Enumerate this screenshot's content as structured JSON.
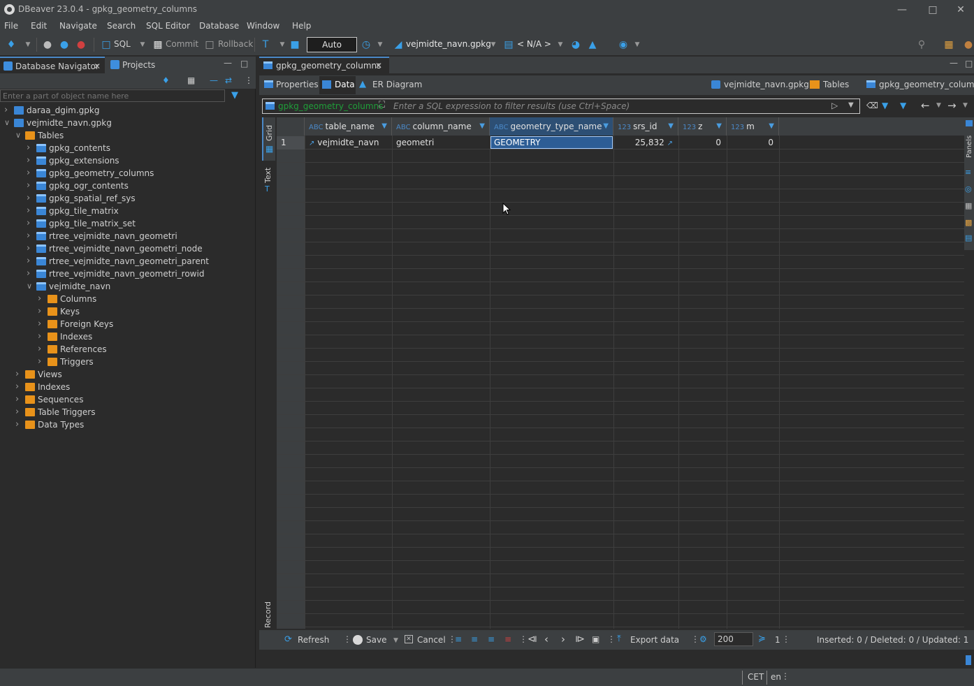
{
  "app": {
    "title": "DBeaver 23.0.4 - gpkg_geometry_columns",
    "window_controls": [
      "minimize-icon",
      "maximize-icon",
      "close-icon"
    ]
  },
  "menu": [
    "File",
    "Edit",
    "Navigate",
    "Search",
    "SQL Editor",
    "Database",
    "Window",
    "Help"
  ],
  "toolbar": {
    "sql_label": "SQL",
    "commit_label": "Commit",
    "rollback_label": "Rollback",
    "transaction_mode": "Auto",
    "active_datasource": "vejmidte_navn.gpkg",
    "active_schema": "< N/A >"
  },
  "left_panel": {
    "tabs": [
      "Database Navigator",
      "Projects"
    ],
    "filter_placeholder": "Enter a part of object name here",
    "tree": [
      {
        "label": "daraa_dgim.gpkg",
        "level": 0,
        "expanded": false,
        "icon": "database-icon"
      },
      {
        "label": "vejmidte_navn.gpkg",
        "level": 0,
        "expanded": true,
        "icon": "database-icon"
      },
      {
        "label": "Tables",
        "level": 1,
        "expanded": true,
        "icon": "tables-folder-icon"
      },
      {
        "label": "gpkg_contents",
        "level": 2,
        "expanded": false,
        "icon": "table-icon"
      },
      {
        "label": "gpkg_extensions",
        "level": 2,
        "expanded": false,
        "icon": "table-icon"
      },
      {
        "label": "gpkg_geometry_columns",
        "level": 2,
        "expanded": false,
        "icon": "table-icon"
      },
      {
        "label": "gpkg_ogr_contents",
        "level": 2,
        "expanded": false,
        "icon": "table-icon"
      },
      {
        "label": "gpkg_spatial_ref_sys",
        "level": 2,
        "expanded": false,
        "icon": "table-icon"
      },
      {
        "label": "gpkg_tile_matrix",
        "level": 2,
        "expanded": false,
        "icon": "table-icon"
      },
      {
        "label": "gpkg_tile_matrix_set",
        "level": 2,
        "expanded": false,
        "icon": "table-icon"
      },
      {
        "label": "rtree_vejmidte_navn_geometri",
        "level": 2,
        "expanded": false,
        "icon": "table-icon"
      },
      {
        "label": "rtree_vejmidte_navn_geometri_node",
        "level": 2,
        "expanded": false,
        "icon": "table-icon"
      },
      {
        "label": "rtree_vejmidte_navn_geometri_parent",
        "level": 2,
        "expanded": false,
        "icon": "table-icon"
      },
      {
        "label": "rtree_vejmidte_navn_geometri_rowid",
        "level": 2,
        "expanded": false,
        "icon": "table-icon"
      },
      {
        "label": "vejmidte_navn",
        "level": 2,
        "expanded": true,
        "icon": "table-icon"
      },
      {
        "label": "Columns",
        "level": 3,
        "expanded": false,
        "icon": "columns-folder-icon"
      },
      {
        "label": "Keys",
        "level": 3,
        "expanded": false,
        "icon": "keys-folder-icon"
      },
      {
        "label": "Foreign Keys",
        "level": 3,
        "expanded": false,
        "icon": "folder-icon"
      },
      {
        "label": "Indexes",
        "level": 3,
        "expanded": false,
        "icon": "folder-icon"
      },
      {
        "label": "References",
        "level": 3,
        "expanded": false,
        "icon": "folder-icon"
      },
      {
        "label": "Triggers",
        "level": 3,
        "expanded": false,
        "icon": "folder-icon"
      },
      {
        "label": "Views",
        "level": 1,
        "expanded": false,
        "icon": "views-folder-icon"
      },
      {
        "label": "Indexes",
        "level": 1,
        "expanded": false,
        "icon": "folder-icon"
      },
      {
        "label": "Sequences",
        "level": 1,
        "expanded": false,
        "icon": "folder-icon"
      },
      {
        "label": "Table Triggers",
        "level": 1,
        "expanded": false,
        "icon": "folder-icon"
      },
      {
        "label": "Data Types",
        "level": 1,
        "expanded": false,
        "icon": "folder-icon"
      }
    ]
  },
  "editor": {
    "tab_title": "gpkg_geometry_columns",
    "sub_tabs": [
      "Properties",
      "Data",
      "ER Diagram"
    ],
    "active_sub_tab": "Data",
    "breadcrumbs": [
      "vejmidte_navn.gpkg",
      "Tables",
      "gpkg_geometry_columns"
    ],
    "filter": {
      "table_name": "gpkg_geometry_columns",
      "placeholder": "Enter a SQL expression to filter results (use Ctrl+Space)"
    },
    "side_tabs": [
      "Grid",
      "Text",
      "Record"
    ],
    "right_side_tab": "Panels",
    "grid": {
      "columns": [
        {
          "name": "table_name",
          "type": "ABC"
        },
        {
          "name": "column_name",
          "type": "ABC"
        },
        {
          "name": "geometry_type_name",
          "type": "ABC"
        },
        {
          "name": "srs_id",
          "type": "123"
        },
        {
          "name": "z",
          "type": "123"
        },
        {
          "name": "m",
          "type": "123"
        }
      ],
      "rows": [
        {
          "rownum": "1",
          "cells": [
            "vejmidte_navn",
            "geometri",
            "GEOMETRY",
            "25,832",
            "0",
            "0"
          ]
        }
      ],
      "selected_cell": "GEOMETRY"
    },
    "bottom_toolbar": {
      "refresh_label": "Refresh",
      "save_label": "Save",
      "cancel_label": "Cancel",
      "export_label": "Export data",
      "fetch_size": "200",
      "row_count": "1",
      "stats": "Inserted: 0 / Deleted: 0 / Updated: 1"
    }
  },
  "status_bar": {
    "timezone": "CET",
    "locale": "en"
  }
}
